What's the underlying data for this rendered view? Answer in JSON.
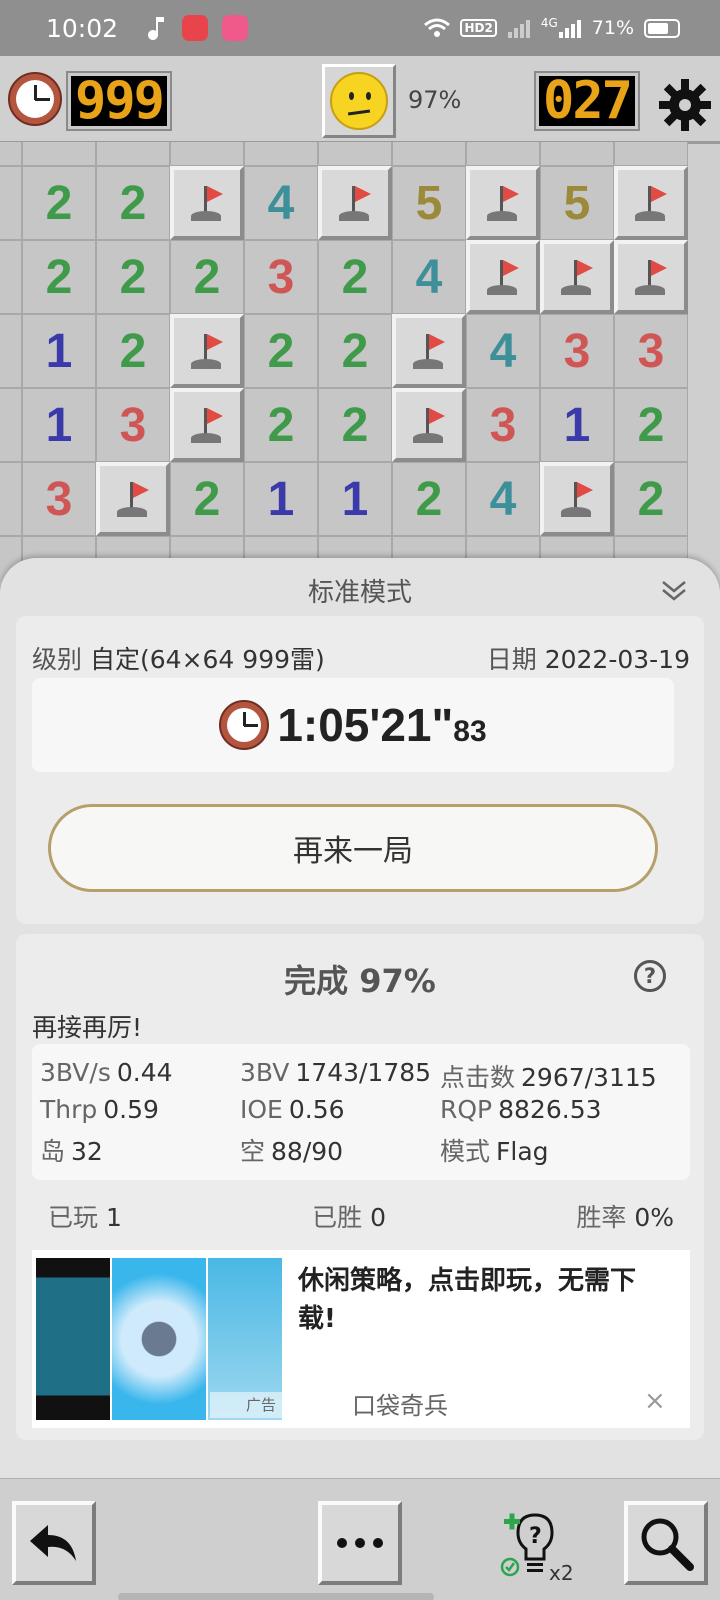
{
  "status_bar": {
    "time": "10:02",
    "network": "4G",
    "hd": "HD2",
    "battery": "71%",
    "battery_level": 0.71
  },
  "game_bar": {
    "timer_value": "999",
    "progress": "97%",
    "mine_counter": "027",
    "face_state": "neutral"
  },
  "board": {
    "rows": [
      [
        "",
        "2",
        "2",
        "F",
        "4",
        "F",
        "5",
        "F",
        "5",
        "F"
      ],
      [
        "",
        "2",
        "2",
        "2",
        "3",
        "2",
        "4",
        "F",
        "F",
        "F"
      ],
      [
        "",
        "1",
        "2",
        "F",
        "2",
        "2",
        "F",
        "4",
        "3",
        "3"
      ],
      [
        "",
        "1",
        "3",
        "F",
        "2",
        "2",
        "F",
        "3",
        "1",
        "2"
      ],
      [
        "",
        "3",
        "F",
        "2",
        "1",
        "1",
        "2",
        "4",
        "F",
        "2"
      ]
    ],
    "number_colors": {
      "1": "#3a3aaa",
      "2": "#3f9a4a",
      "3": "#d05656",
      "4": "#3d8f9a",
      "5": "#9a8a3a"
    }
  },
  "sheet": {
    "mode_title": "标准模式",
    "level_label": "级别",
    "level_value": "自定(64×64  999雷)",
    "date_label": "日期",
    "date_value": "2022-03-19",
    "elapsed_main": "1:05'21\"",
    "elapsed_sub": "83",
    "play_again": "再来一局",
    "complete_title": "完成 97%",
    "help": "?",
    "encourage": "再接再厉!",
    "stats": [
      {
        "key": "3BV/s",
        "value": "0.44"
      },
      {
        "key": "3BV",
        "value": "1743/1785"
      },
      {
        "key": "点击数",
        "value": "2967/3115"
      },
      {
        "key": "Thrp",
        "value": "0.59"
      },
      {
        "key": "IOE",
        "value": "0.56"
      },
      {
        "key": "RQP",
        "value": "8826.53"
      },
      {
        "key": "岛",
        "value": "32"
      },
      {
        "key": "空",
        "value": "88/90"
      },
      {
        "key": "模式",
        "value": "Flag"
      }
    ],
    "played_label": "已玩",
    "played_value": "1",
    "won_label": "已胜",
    "won_value": "0",
    "rate_label": "胜率",
    "rate_value": "0%"
  },
  "ad": {
    "text": "休闲策略，点击即玩，无需下载!",
    "brand": "口袋奇兵",
    "badge": "广告",
    "close": "×"
  },
  "toolbar": {
    "hint_count": "x2"
  }
}
